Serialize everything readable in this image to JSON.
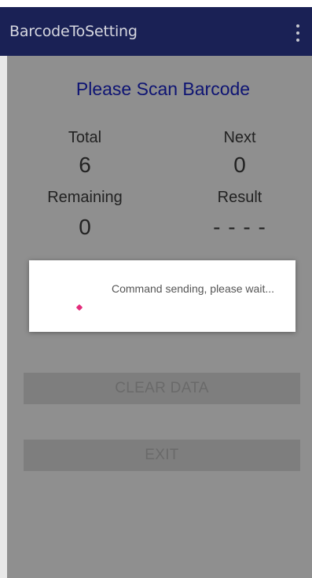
{
  "app_bar": {
    "title": "BarcodeToSetting",
    "overflow_icon": "more-vert-icon",
    "background": "#1a2155"
  },
  "main": {
    "heading": "Please Scan Barcode",
    "heading_color": "#0e1473",
    "stats": {
      "total_label": "Total",
      "total_value": "6",
      "next_label": "Next",
      "next_value": "0",
      "remaining_label": "Remaining",
      "remaining_value": "0",
      "result_label": "Result",
      "result_value": "- - - -"
    },
    "buttons": {
      "clear_label": "CLEAR DATA",
      "exit_label": "EXIT"
    }
  },
  "dialog": {
    "message": "Command sending, please wait...",
    "spinner_icon": "progress-spinner-icon",
    "accent": "#e32c7b"
  }
}
